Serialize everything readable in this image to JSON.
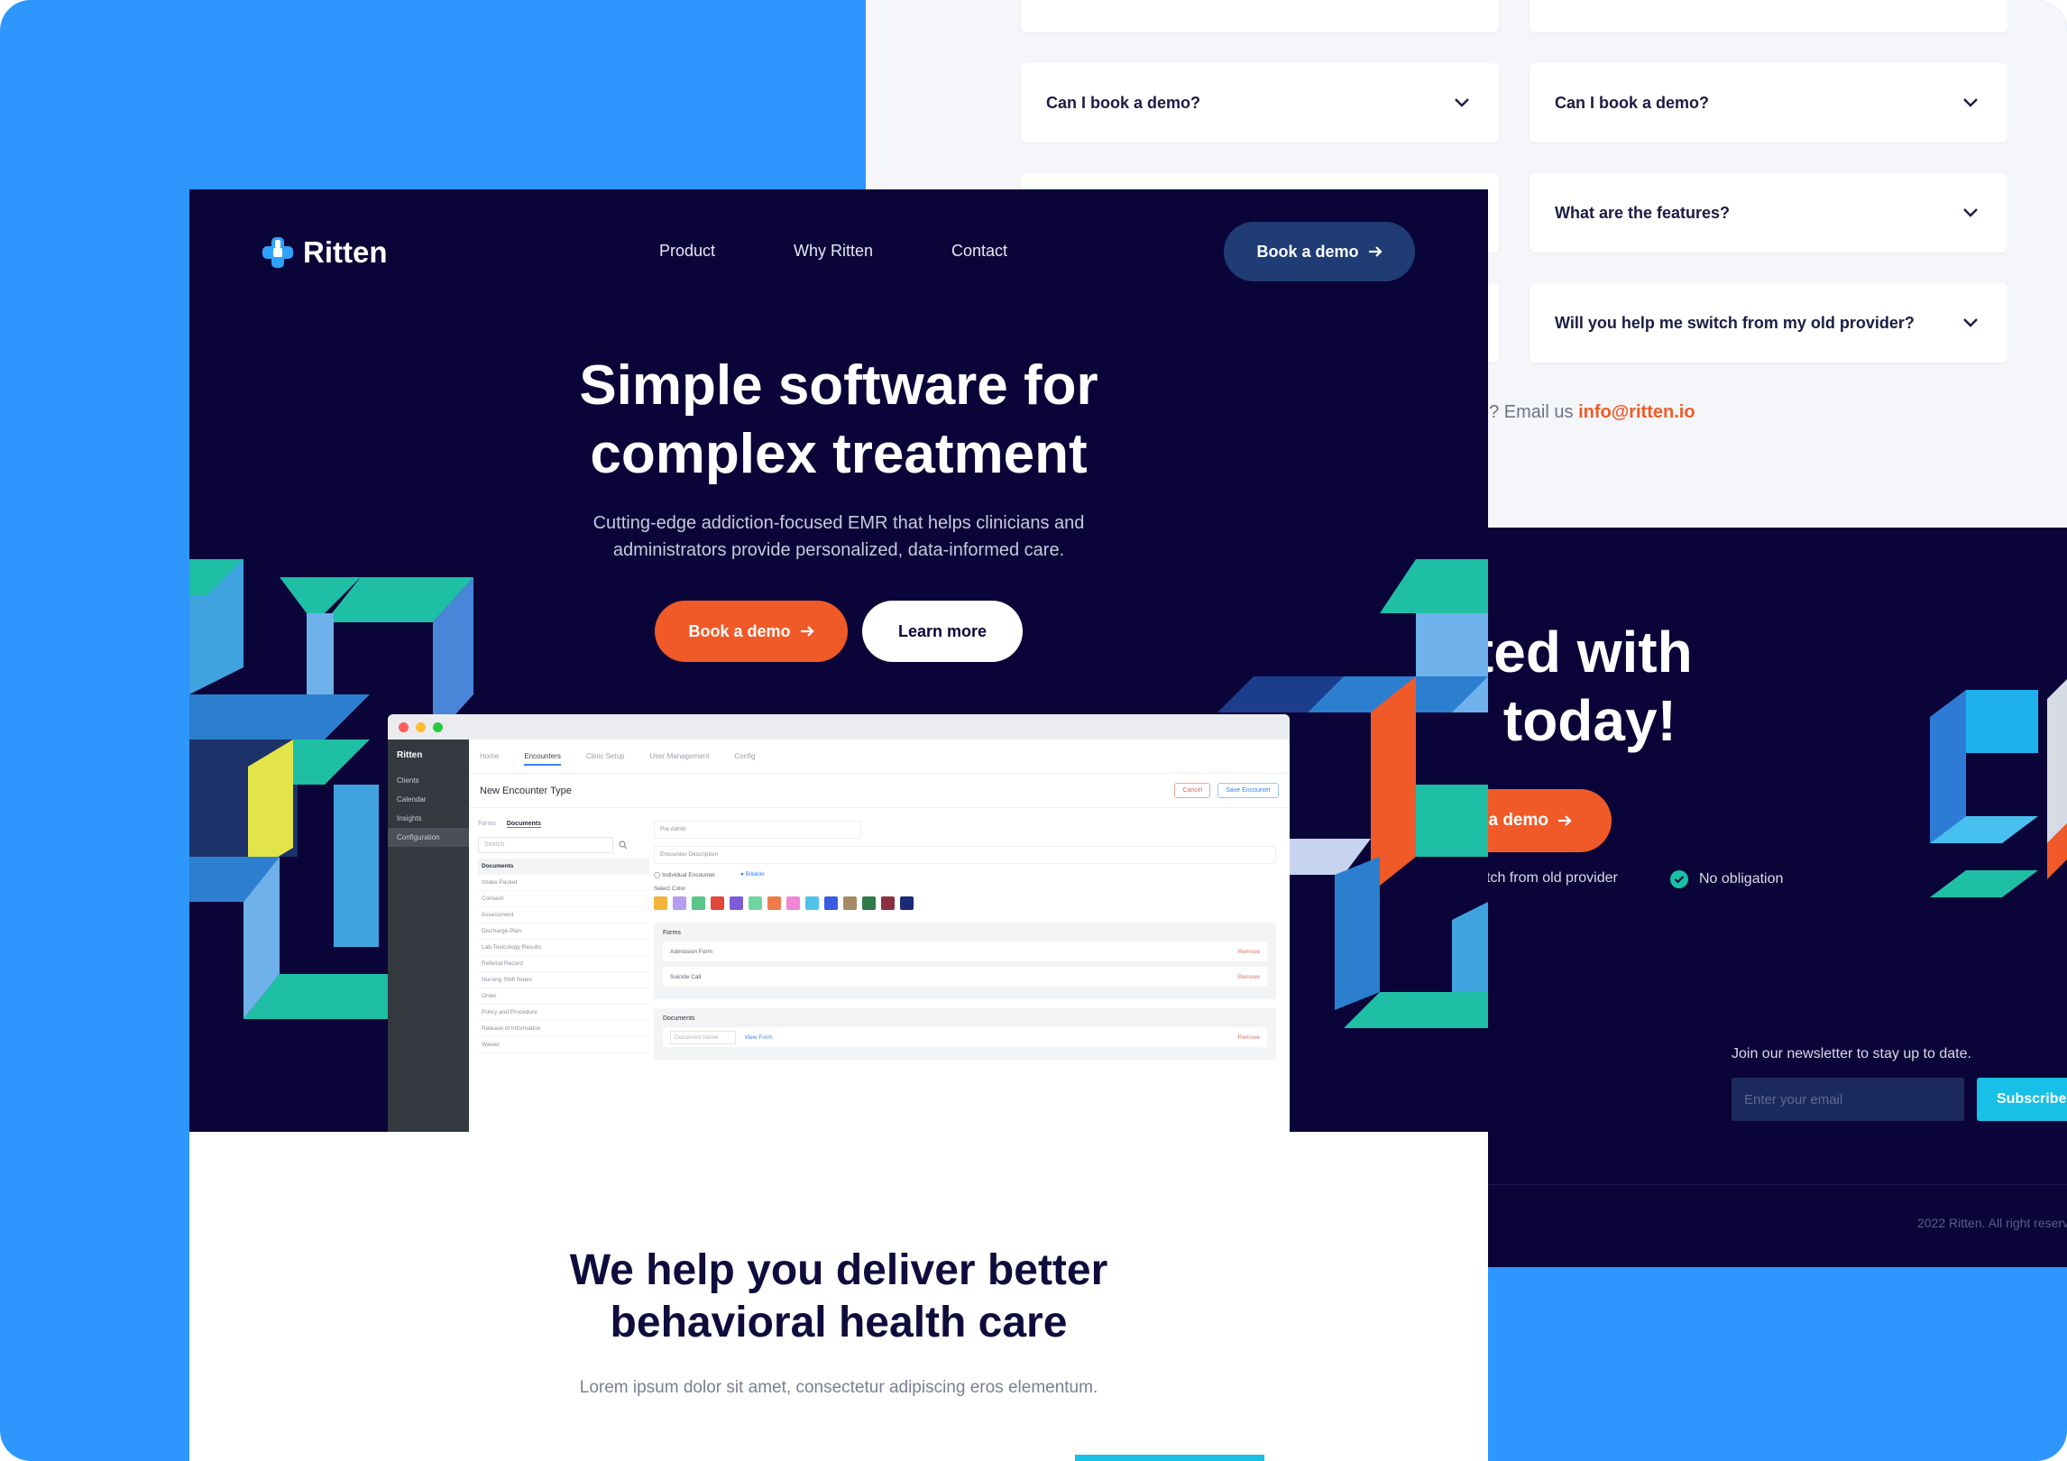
{
  "colors": {
    "background": "#2d96ff",
    "navy": "#0b0438",
    "orange": "#f05a28",
    "teal": "#19c1a4",
    "cyan": "#18bfe6"
  },
  "back": {
    "faq": [
      {
        "q": "Can I book a demo?"
      },
      {
        "q": "Can I book a demo?"
      },
      {
        "q": "What are the features?"
      },
      {
        "q": "Will you help me switch from my old provider?"
      }
    ],
    "email_prefix": "n? Email us",
    "email_link": "info@ritten.io",
    "cta_title_1": "rted with",
    "cta_title_2": "n today!",
    "cta_button": "k a demo",
    "checks": [
      "tch from old provider",
      "No obligation"
    ],
    "newsletter_label": "Join our newsletter to stay up to date.",
    "newsletter_placeholder": "Enter your email",
    "subscribe": "Subscribe",
    "copyright": "2022 Ritten. All right reserv"
  },
  "nav": {
    "logo": "Ritten",
    "links": [
      "Product",
      "Why Ritten",
      "Contact"
    ],
    "cta": "Book a demo"
  },
  "hero": {
    "title_1": "Simple software for",
    "title_2": "complex treatment",
    "subtitle_1": "Cutting-edge addiction-focused EMR that helps clinicians and",
    "subtitle_2": "administrators provide personalized, data-informed care.",
    "primary": "Book a demo",
    "secondary": "Learn more"
  },
  "app": {
    "brand": "Ritten",
    "side": [
      "Clients",
      "Calendar",
      "Insights",
      "Configuration"
    ],
    "tabs": [
      "Home",
      "Encounters",
      "Clinic Setup",
      "User Management",
      "Config"
    ],
    "header": "New Encounter Type",
    "cancel": "Cancel",
    "save": "Save Encounter",
    "left_tabs": [
      "Forms",
      "Documents"
    ],
    "search": "Search",
    "doc_head": "Documents",
    "docs": [
      "Intake Packet",
      "Consent",
      "Assessment",
      "Discharge Plan",
      "Lab Toxicology Results",
      "Referral Record",
      "Nursing Shift Notes",
      "Order",
      "Policy and Procedure",
      "Release of Information",
      "Waiver"
    ],
    "field_name": "Pre Admit",
    "field_desc": "Encounter Description",
    "radio_1": "Individual Encounter",
    "radio_2": "Billable",
    "color_label": "Select Color",
    "swatches": [
      "#f3b23a",
      "#b79cf0",
      "#5cc48a",
      "#e2463c",
      "#7b5cd6",
      "#6fd6a0",
      "#f07a4a",
      "#ee86d6",
      "#4fc4e8",
      "#3a5ce0",
      "#a58b64",
      "#2f7a4a",
      "#8a3040",
      "#1a2a78"
    ],
    "forms_title": "Forms",
    "forms": [
      "Admission Form",
      "Suicide Call"
    ],
    "docs_title": "Documents",
    "doc_input": "Document Name",
    "view_form": "View Form",
    "remove": "Remove"
  },
  "lower": {
    "title_1": "We help you deliver better",
    "title_2": "behavioral health care",
    "subtitle": "Lorem ipsum dolor sit amet, consectetur adipiscing eros elementum."
  }
}
